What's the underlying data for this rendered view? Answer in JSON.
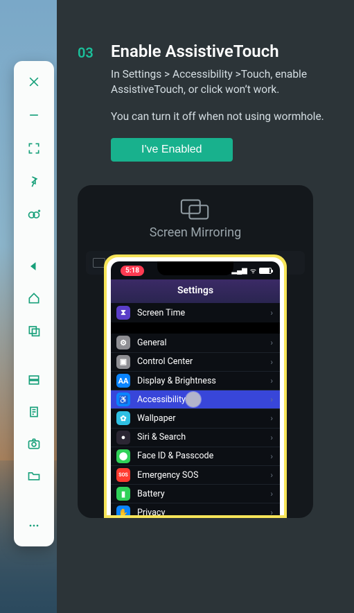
{
  "step": {
    "number": "03",
    "title": "Enable AssistiveTouch",
    "description": "In Settings > Accessibility >Touch, enable AssistiveTouch, or click won’t work.",
    "note": "You can turn it off when not using wormhole.",
    "button_label": "I've Enabled"
  },
  "illustration": {
    "mirror_label": "Screen Mirroring",
    "statusbar_time": "5:18",
    "phone_header": "Settings",
    "rows_top": [
      {
        "label": "Screen Time",
        "icon_bg": "#5a3ec8",
        "glyph": "⧗"
      }
    ],
    "rows_main": [
      {
        "label": "General",
        "icon_bg": "#8e8e93",
        "glyph": "⚙"
      },
      {
        "label": "Control Center",
        "icon_bg": "#8e8e93",
        "glyph": "▣"
      },
      {
        "label": "Display & Brightness",
        "icon_bg": "#0a84ff",
        "glyph": "AA"
      },
      {
        "label": "Accessibility",
        "icon_bg": "#0a84ff",
        "glyph": "♿",
        "highlight": true,
        "tap": true
      },
      {
        "label": "Wallpaper",
        "icon_bg": "#2fc0e3",
        "glyph": "✿"
      },
      {
        "label": "Siri & Search",
        "icon_bg": "#2b2633",
        "glyph": "●"
      },
      {
        "label": "Face ID & Passcode",
        "icon_bg": "#30d158",
        "glyph": "⬤"
      },
      {
        "label": "Emergency SOS",
        "icon_bg": "#ff3b30",
        "glyph": "SOS"
      },
      {
        "label": "Battery",
        "icon_bg": "#30d158",
        "glyph": "▮"
      },
      {
        "label": "Privacy",
        "icon_bg": "#0a84ff",
        "glyph": "✋"
      }
    ]
  },
  "toolbar": {
    "group1": [
      "close",
      "minimize",
      "fullscreen",
      "pin",
      "loop-add"
    ],
    "group2": [
      "back",
      "home",
      "recents"
    ],
    "group3": [
      "server",
      "clipboard",
      "camera",
      "folder"
    ],
    "more": "more"
  }
}
